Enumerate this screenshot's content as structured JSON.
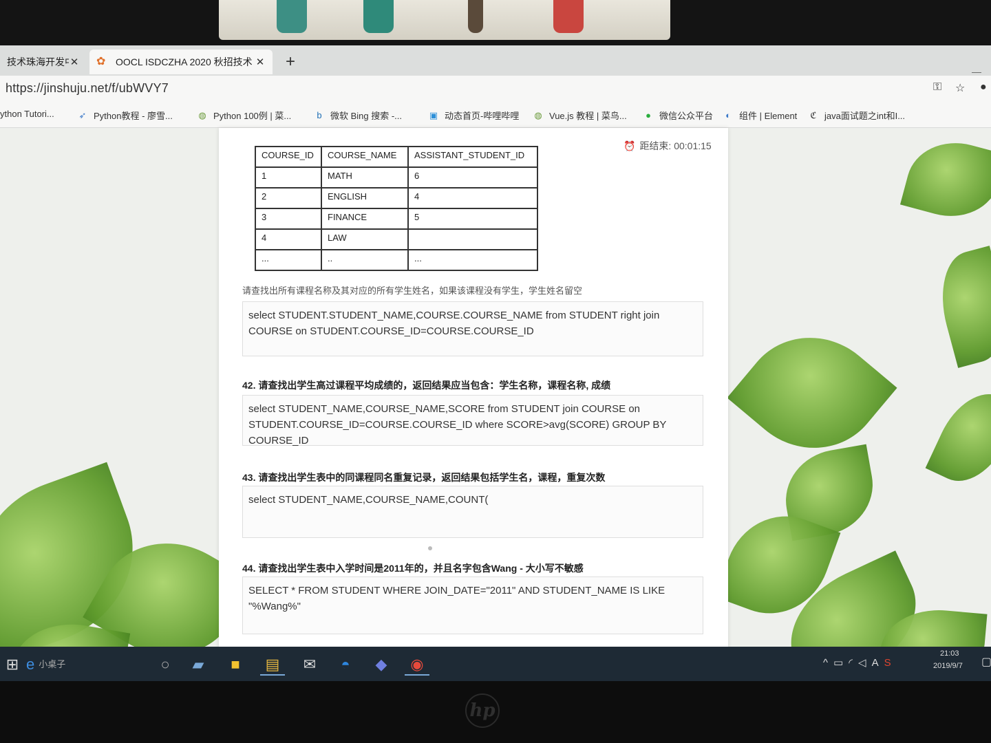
{
  "browser": {
    "tabs": [
      {
        "label": "技术珠海开发中",
        "active": false
      },
      {
        "label": "OOCL ISDCZHA 2020 秋招技术",
        "active": true
      }
    ],
    "new_tab": "+",
    "url": "https://jinshuju.net/f/ubWVY7",
    "bookmarks": [
      "ython Tutori...",
      "Python教程 - 廖雪...",
      "Python 100例 | 菜...",
      "微软 Bing 搜索 -...",
      "动态首页-哔哩哔哩",
      "Vue.js 教程 | 菜鸟...",
      "微信公众平台",
      "组件 | Element",
      "java面试题之int和I..."
    ]
  },
  "form": {
    "timer": "距结束: 00:01:15",
    "table": {
      "headers": [
        "COURSE_ID",
        "COURSE_NAME",
        "ASSISTANT_STUDENT_ID"
      ],
      "rows": [
        [
          "1",
          "MATH",
          "6"
        ],
        [
          "2",
          "ENGLISH",
          "4"
        ],
        [
          "3",
          "FINANCE",
          "5"
        ],
        [
          "4",
          "LAW",
          ""
        ],
        [
          "...",
          "..",
          "..."
        ]
      ]
    },
    "q41_prompt": "请查找出所有课程名称及其对应的所有学生姓名，如果该课程没有学生，学生姓名留空",
    "q41_answer": "select STUDENT.STUDENT_NAME,COURSE.COURSE_NAME from STUDENT right join COURSE on STUDENT.COURSE_ID=COURSE.COURSE_ID",
    "q42_title": "42. 请查找出学生高过课程平均成绩的，返回结果应当包含：学生名称，课程名称, 成绩",
    "q42_answer": "select STUDENT_NAME,COURSE_NAME,SCORE from STUDENT  join COURSE on STUDENT.COURSE_ID=COURSE.COURSE_ID  where SCORE>avg(SCORE) GROUP BY COURSE_ID",
    "q43_title": "43. 请查找出学生表中的同课程同名重复记录，返回结果包括学生名，课程，重复次数",
    "q43_answer": "select STUDENT_NAME,COURSE_NAME,COUNT(",
    "q44_title": "44. 请查找出学生表中入学时间是2011年的，并且名字包含Wang - 大小写不敏感",
    "q44_answer": "SELECT * FROM STUDENT WHERE JOIN_DATE=\"2011\" AND STUDENT_NAME IS LIKE \"%Wang%\""
  },
  "taskbar": {
    "edge_label": "小桌子",
    "time": "21:03",
    "date": "2019/9/7",
    "tray_ime": "A"
  }
}
